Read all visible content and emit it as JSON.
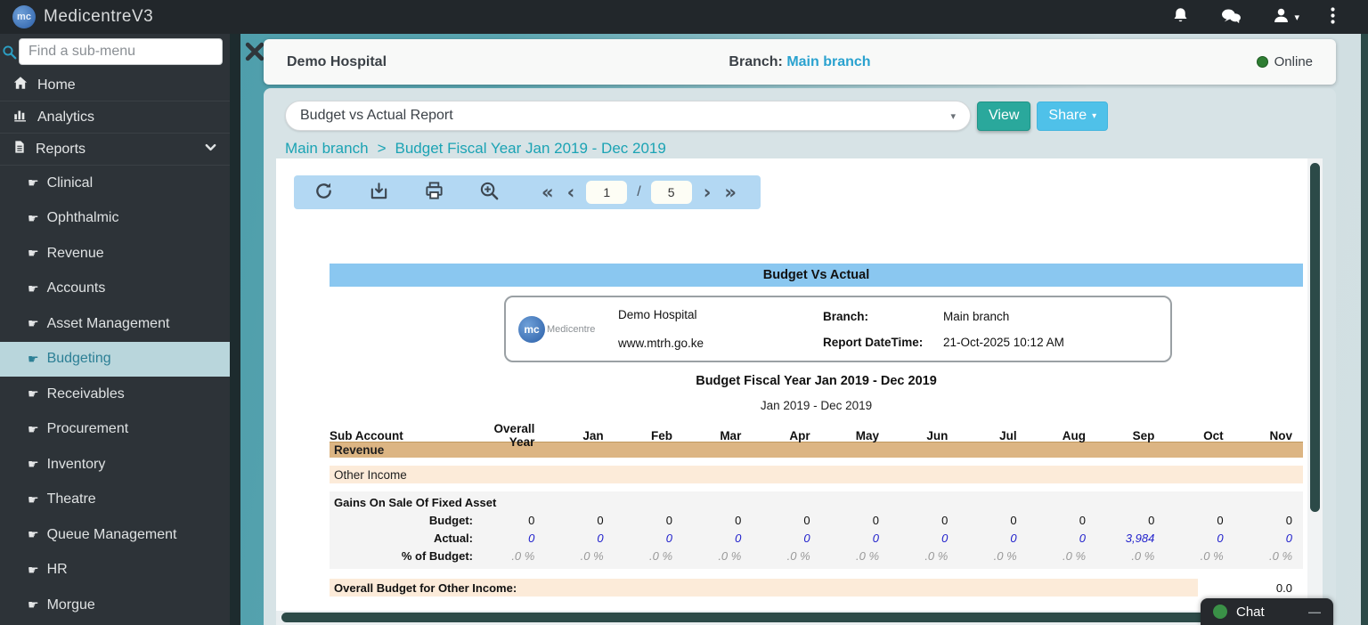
{
  "topbar": {
    "app_name": "MedicentreV3",
    "logo_text": "mc"
  },
  "sidebar": {
    "search_placeholder": "Find a sub-menu",
    "items": [
      {
        "label": "Home"
      },
      {
        "label": "Analytics"
      },
      {
        "label": "Reports",
        "expanded": true
      }
    ],
    "sub_items": [
      {
        "label": "Clinical"
      },
      {
        "label": "Ophthalmic"
      },
      {
        "label": "Revenue"
      },
      {
        "label": "Accounts"
      },
      {
        "label": "Asset Management"
      },
      {
        "label": "Budgeting",
        "selected": true
      },
      {
        "label": "Receivables"
      },
      {
        "label": "Procurement"
      },
      {
        "label": "Inventory"
      },
      {
        "label": "Theatre"
      },
      {
        "label": "Queue Management"
      },
      {
        "label": "HR"
      },
      {
        "label": "Morgue"
      }
    ]
  },
  "header": {
    "hospital_name": "Demo Hospital",
    "branch_label": "Branch:",
    "branch_value": "Main branch",
    "status": "Online"
  },
  "controls": {
    "report_select_value": "Budget vs Actual Report",
    "view_label": "View",
    "share_label": "Share"
  },
  "breadcrumb": {
    "branch": "Main branch",
    "separator": ">",
    "report": "Budget Fiscal Year Jan 2019 - Dec 2019"
  },
  "viewer": {
    "toolbar": {
      "page_current": "1",
      "page_separator": "/",
      "page_total": "5",
      "glyph_first": "«",
      "glyph_prev": "‹",
      "glyph_next": "›",
      "glyph_last": "»"
    },
    "report": {
      "title": "Budget Vs Actual",
      "org": {
        "logo_text": "mc",
        "logo_brand": "Medicentre",
        "name": "Demo Hospital",
        "website": "www.mtrh.go.ke",
        "branch_label": "Branch:",
        "branch_value": "Main branch",
        "datetime_label": "Report DateTime:",
        "datetime_value": "21-Oct-2025 10:12 AM"
      },
      "fiscal_title": "Budget Fiscal Year Jan 2019 - Dec 2019",
      "period": "Jan 2019 - Dec 2019",
      "table": {
        "columns": [
          "Sub Account",
          "Overall Year",
          "Jan",
          "Feb",
          "Mar",
          "Apr",
          "May",
          "Jun",
          "Jul",
          "Aug",
          "Sep",
          "Oct",
          "Nov"
        ],
        "section": "Revenue",
        "subsection": "Other Income",
        "group": "Gains On Sale Of Fixed Asset",
        "budget_row": {
          "label": "Budget:",
          "values": [
            "0",
            "0",
            "0",
            "0",
            "0",
            "0",
            "0",
            "0",
            "0",
            "0",
            "0",
            "0"
          ]
        },
        "actual_row": {
          "label": "Actual:",
          "values": [
            "0",
            "0",
            "0",
            "0",
            "0",
            "0",
            "0",
            "0",
            "0",
            "3,984",
            "0",
            "0"
          ]
        },
        "pct_row": {
          "label": "% of Budget:",
          "values": [
            ".0 %",
            ".0 %",
            ".0 %",
            ".0 %",
            ".0 %",
            ".0 %",
            ".0 %",
            ".0 %",
            ".0 %",
            ".0 %",
            ".0 %",
            ".0 %"
          ]
        },
        "footer": {
          "label": "Overall Budget for Other Income:",
          "value": "0.0"
        }
      }
    }
  },
  "chat": {
    "label": "Chat",
    "minimize_glyph": "—"
  },
  "icons": {
    "caret_down": "▾"
  },
  "colors": {
    "topbar_bg": "#22272b",
    "sidebar_bg": "#2d3338",
    "selected_item_bg": "#b9d6dc",
    "selected_item_text": "#2c7f95",
    "teal_bg": "#4e9eab",
    "panel_bg": "#d7e3e6",
    "link_blue": "#2aa2cf",
    "breadcrumb_teal": "#1ba3b4",
    "view_btn": "#2aa89c",
    "share_btn": "#4fc1e9",
    "toolbar_bg": "#b3d8f3",
    "report_title_band": "#8ac7f0",
    "revenue_band": "#dcb583",
    "subsection_band": "#fcebd9",
    "actual_value_blue": "#2222cc",
    "online_dot": "#2e7d32",
    "chat_dot": "#3a9147",
    "scrollbar_thumb": "#2c4a48"
  }
}
